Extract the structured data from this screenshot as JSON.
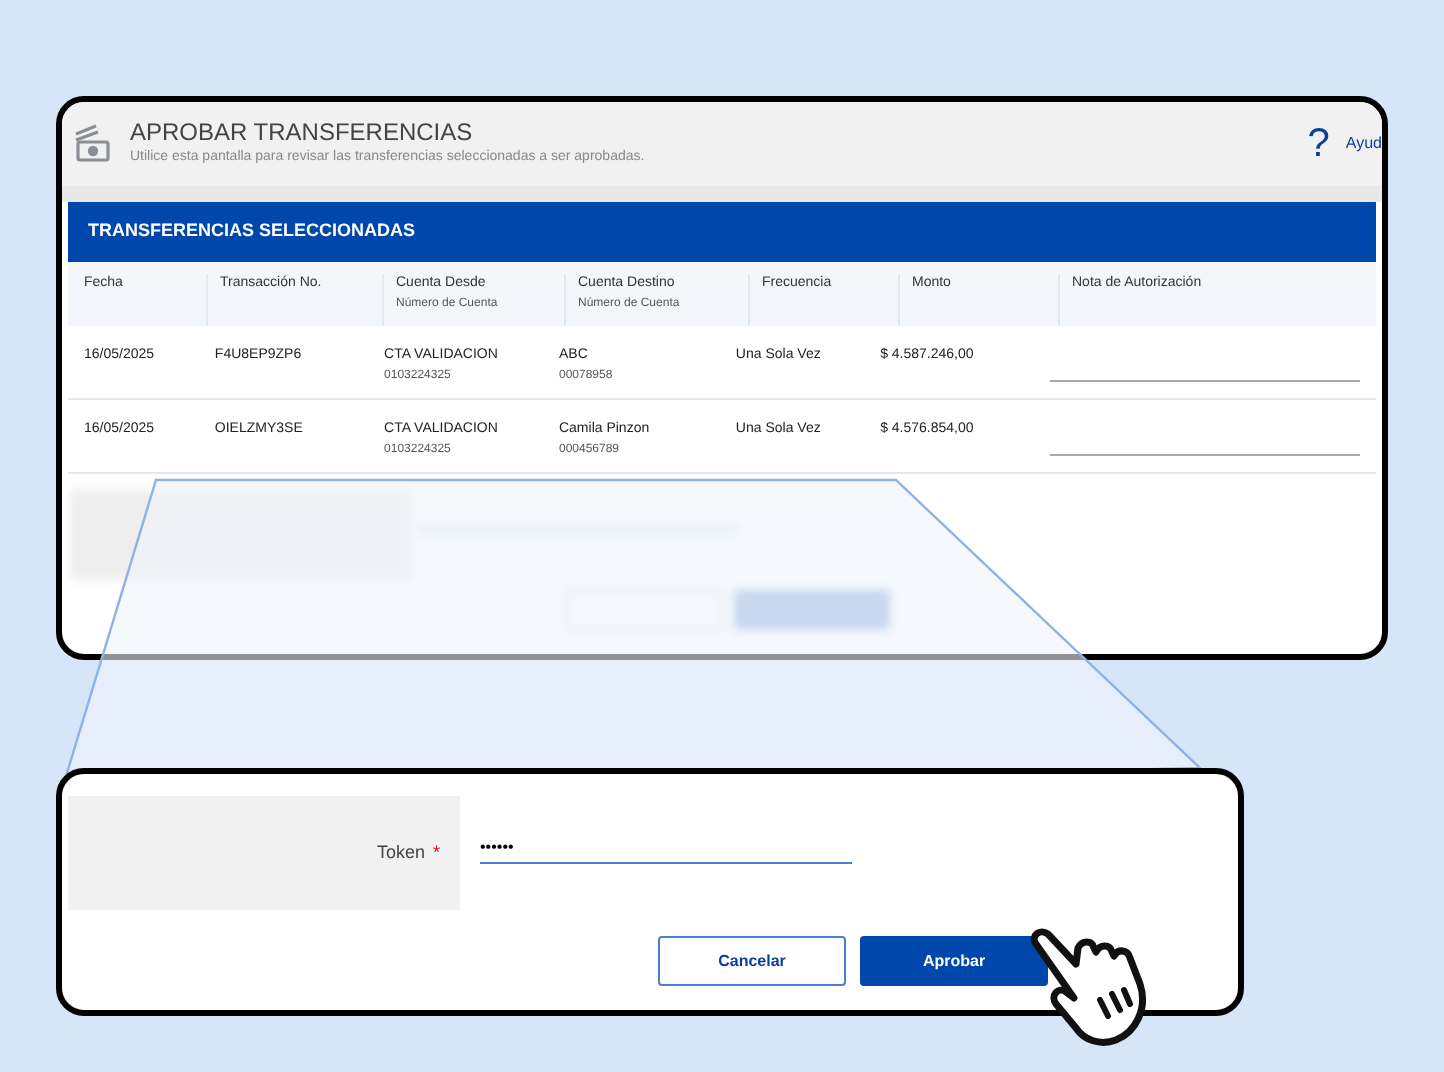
{
  "header": {
    "title": "APROBAR TRANSFERENCIAS",
    "subtitle": "Utilice esta pantalla para revisar las transferencias seleccionadas a ser aprobadas.",
    "help_icon": "?",
    "help": "Ayud"
  },
  "section_title": "TRANSFERENCIAS SELECCIONADAS",
  "table": {
    "columns": [
      {
        "label": "Fecha"
      },
      {
        "label": "Transacción No."
      },
      {
        "label": "Cuenta Desde",
        "sublabel": "Número de Cuenta"
      },
      {
        "label": "Cuenta Destino",
        "sublabel": "Número de Cuenta"
      },
      {
        "label": "Frecuencia"
      },
      {
        "label": "Monto"
      },
      {
        "label": "Nota de Autorización"
      }
    ],
    "rows": [
      {
        "cells": [
          {
            "text": "16/05/2025"
          },
          {
            "text": "F4U8EP9ZP6"
          },
          {
            "text": "CTA VALIDACION",
            "sub": "0103224325"
          },
          {
            "text": "ABC",
            "sub": "00078958"
          },
          {
            "text": "Una Sola Vez"
          },
          {
            "text": "$ 4.587.246,00"
          }
        ]
      },
      {
        "cells": [
          {
            "text": "16/05/2025"
          },
          {
            "text": "OIELZMY3SE"
          },
          {
            "text": "CTA VALIDACION",
            "sub": "0103224325"
          },
          {
            "text": "Camila Pinzon",
            "sub": "000456789"
          },
          {
            "text": "Una Sola Vez"
          },
          {
            "text": "$ 4.576.854,00"
          }
        ]
      }
    ]
  },
  "token": {
    "label": "Token",
    "required_mark": "*",
    "value": "••••••"
  },
  "buttons": [
    {
      "label": "Cancelar",
      "kind": "secondary"
    },
    {
      "label": "Aprobar",
      "kind": "primary"
    }
  ]
}
